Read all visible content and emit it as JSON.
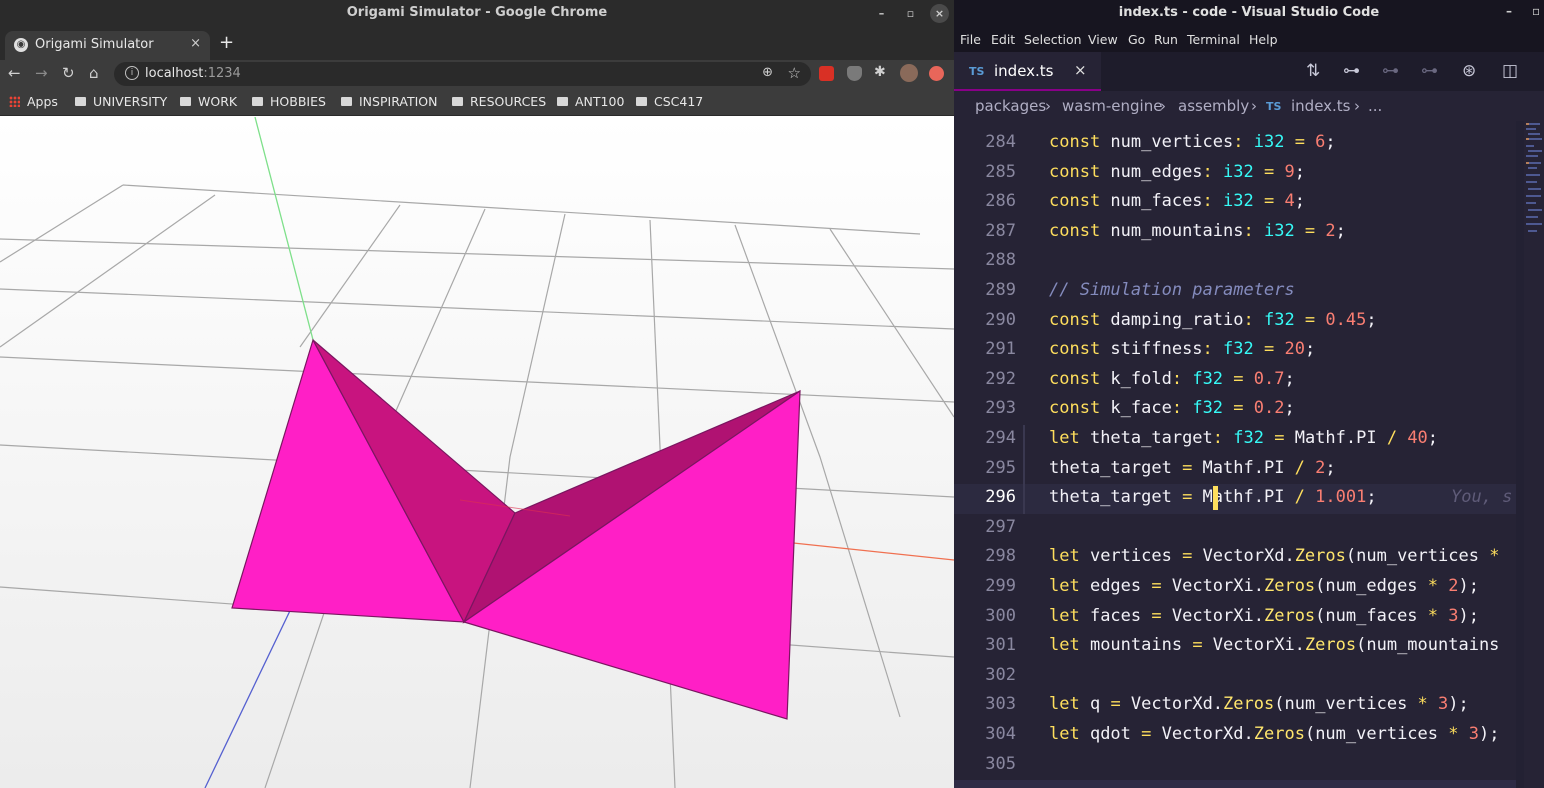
{
  "chrome": {
    "window_title": "Origami Simulator - Google Chrome",
    "tab": {
      "title": "Origami Simulator",
      "close": "×"
    },
    "new_tab": "+",
    "address": {
      "host": "localhost",
      "port": ":1234"
    },
    "bookmarks": [
      "Apps",
      "UNIVERSITY",
      "WORK",
      "HOBBIES",
      "INSPIRATION",
      "RESOURCES",
      "ANT100",
      "CSC417"
    ],
    "scene": {
      "fold_color": "#ff1fc6",
      "fold_shade": "#c8147f",
      "grid_color": "#a8a8a8"
    }
  },
  "vscode": {
    "window_title": "index.ts - code - Visual Studio Code",
    "menu": [
      "File",
      "Edit",
      "Selection",
      "View",
      "Go",
      "Run",
      "Terminal",
      "Help"
    ],
    "tab": {
      "icon": "TS",
      "name": "index.ts",
      "close": "×"
    },
    "breadcrumb": [
      "packages",
      "wasm-engine",
      "assembly",
      "TS",
      "index.ts",
      "..."
    ],
    "blame": "You, s",
    "lines": [
      {
        "n": "284",
        "tokens": [
          [
            "kw",
            "const "
          ],
          [
            "var",
            "num_vertices"
          ],
          [
            "kw",
            ": "
          ],
          [
            "typ",
            "i32"
          ],
          [
            "op",
            " = "
          ],
          [
            "num",
            "6"
          ],
          [
            "pn",
            ";"
          ]
        ]
      },
      {
        "n": "285",
        "tokens": [
          [
            "kw",
            "const "
          ],
          [
            "var",
            "num_edges"
          ],
          [
            "kw",
            ": "
          ],
          [
            "typ",
            "i32"
          ],
          [
            "op",
            " = "
          ],
          [
            "num",
            "9"
          ],
          [
            "pn",
            ";"
          ]
        ]
      },
      {
        "n": "286",
        "tokens": [
          [
            "kw",
            "const "
          ],
          [
            "var",
            "num_faces"
          ],
          [
            "kw",
            ": "
          ],
          [
            "typ",
            "i32"
          ],
          [
            "op",
            " = "
          ],
          [
            "num",
            "4"
          ],
          [
            "pn",
            ";"
          ]
        ]
      },
      {
        "n": "287",
        "tokens": [
          [
            "kw",
            "const "
          ],
          [
            "var",
            "num_mountains"
          ],
          [
            "kw",
            ": "
          ],
          [
            "typ",
            "i32"
          ],
          [
            "op",
            " = "
          ],
          [
            "num",
            "2"
          ],
          [
            "pn",
            ";"
          ]
        ]
      },
      {
        "n": "288",
        "tokens": []
      },
      {
        "n": "289",
        "tokens": [
          [
            "com",
            "// Simulation parameters"
          ]
        ]
      },
      {
        "n": "290",
        "tokens": [
          [
            "kw",
            "const "
          ],
          [
            "var",
            "damping_ratio"
          ],
          [
            "kw",
            ": "
          ],
          [
            "typ",
            "f32"
          ],
          [
            "op",
            " = "
          ],
          [
            "num",
            "0.45"
          ],
          [
            "pn",
            ";"
          ]
        ]
      },
      {
        "n": "291",
        "tokens": [
          [
            "kw",
            "const "
          ],
          [
            "var",
            "stiffness"
          ],
          [
            "kw",
            ": "
          ],
          [
            "typ",
            "f32"
          ],
          [
            "op",
            " = "
          ],
          [
            "num",
            "20"
          ],
          [
            "pn",
            ";"
          ]
        ]
      },
      {
        "n": "292",
        "tokens": [
          [
            "kw",
            "const "
          ],
          [
            "var",
            "k_fold"
          ],
          [
            "kw",
            ": "
          ],
          [
            "typ",
            "f32"
          ],
          [
            "op",
            " = "
          ],
          [
            "num",
            "0.7"
          ],
          [
            "pn",
            ";"
          ]
        ]
      },
      {
        "n": "293",
        "tokens": [
          [
            "kw",
            "const "
          ],
          [
            "var",
            "k_face"
          ],
          [
            "kw",
            ": "
          ],
          [
            "typ",
            "f32"
          ],
          [
            "op",
            " = "
          ],
          [
            "num",
            "0.2"
          ],
          [
            "pn",
            ";"
          ]
        ]
      },
      {
        "n": "294",
        "tokens": [
          [
            "kw",
            "let "
          ],
          [
            "var",
            "theta_target"
          ],
          [
            "kw",
            ": "
          ],
          [
            "typ",
            "f32"
          ],
          [
            "op",
            " = "
          ],
          [
            "var",
            "Mathf.PI"
          ],
          [
            "op",
            " / "
          ],
          [
            "num",
            "40"
          ],
          [
            "pn",
            ";"
          ]
        ]
      },
      {
        "n": "295",
        "tokens": [
          [
            "var",
            "theta_target"
          ],
          [
            "op",
            " = "
          ],
          [
            "var",
            "Mathf.PI"
          ],
          [
            "op",
            " / "
          ],
          [
            "num",
            "2"
          ],
          [
            "pn",
            ";"
          ]
        ]
      },
      {
        "n": "296",
        "tokens": [
          [
            "var",
            "theta_target"
          ],
          [
            "op",
            " = "
          ],
          [
            "var",
            "Mathf.PI"
          ],
          [
            "op",
            " / "
          ],
          [
            "num",
            "1.001"
          ],
          [
            "pn",
            ";"
          ]
        ]
      },
      {
        "n": "297",
        "tokens": []
      },
      {
        "n": "298",
        "tokens": [
          [
            "kw",
            "let "
          ],
          [
            "var",
            "vertices"
          ],
          [
            "op",
            " = "
          ],
          [
            "var",
            "VectorXd."
          ],
          [
            "fn",
            "Zeros"
          ],
          [
            "pn",
            "("
          ],
          [
            "var",
            "num_vertices"
          ],
          [
            "op",
            " *"
          ]
        ]
      },
      {
        "n": "299",
        "tokens": [
          [
            "kw",
            "let "
          ],
          [
            "var",
            "edges"
          ],
          [
            "op",
            " = "
          ],
          [
            "var",
            "VectorXi."
          ],
          [
            "fn",
            "Zeros"
          ],
          [
            "pn",
            "("
          ],
          [
            "var",
            "num_edges"
          ],
          [
            "op",
            " * "
          ],
          [
            "num",
            "2"
          ],
          [
            "pn",
            ");"
          ]
        ]
      },
      {
        "n": "300",
        "tokens": [
          [
            "kw",
            "let "
          ],
          [
            "var",
            "faces"
          ],
          [
            "op",
            " = "
          ],
          [
            "var",
            "VectorXi."
          ],
          [
            "fn",
            "Zeros"
          ],
          [
            "pn",
            "("
          ],
          [
            "var",
            "num_faces"
          ],
          [
            "op",
            " * "
          ],
          [
            "num",
            "3"
          ],
          [
            "pn",
            ");"
          ]
        ]
      },
      {
        "n": "301",
        "tokens": [
          [
            "kw",
            "let "
          ],
          [
            "var",
            "mountains"
          ],
          [
            "op",
            " = "
          ],
          [
            "var",
            "VectorXi."
          ],
          [
            "fn",
            "Zeros"
          ],
          [
            "pn",
            "("
          ],
          [
            "var",
            "num_mountains"
          ]
        ]
      },
      {
        "n": "302",
        "tokens": []
      },
      {
        "n": "303",
        "tokens": [
          [
            "kw",
            "let "
          ],
          [
            "var",
            "q"
          ],
          [
            "op",
            " = "
          ],
          [
            "var",
            "VectorXd."
          ],
          [
            "fn",
            "Zeros"
          ],
          [
            "pn",
            "("
          ],
          [
            "var",
            "num_vertices"
          ],
          [
            "op",
            " * "
          ],
          [
            "num",
            "3"
          ],
          [
            "pn",
            ");"
          ]
        ]
      },
      {
        "n": "304",
        "tokens": [
          [
            "kw",
            "let "
          ],
          [
            "var",
            "qdot"
          ],
          [
            "op",
            " = "
          ],
          [
            "var",
            "VectorXd."
          ],
          [
            "fn",
            "Zeros"
          ],
          [
            "pn",
            "("
          ],
          [
            "var",
            "num_vertices"
          ],
          [
            "op",
            " * "
          ],
          [
            "num",
            "3"
          ],
          [
            "pn",
            ");"
          ]
        ]
      },
      {
        "n": "305",
        "tokens": []
      }
    ]
  }
}
